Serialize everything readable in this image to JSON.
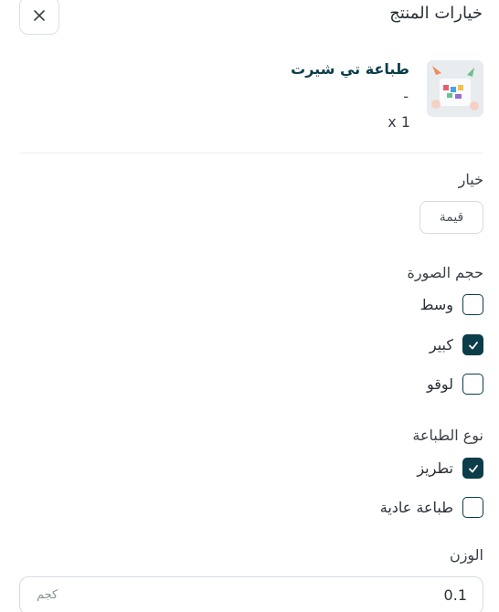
{
  "header": {
    "title": "خيارات المنتج",
    "close_icon": "close-icon"
  },
  "product": {
    "name": "طباعة تي شيرت",
    "variant": "-",
    "quantity": "x 1",
    "image_icon": "product-thumbnail"
  },
  "option_group": {
    "label": "خيار",
    "chip": "قيمة"
  },
  "image_size": {
    "label": "حجم الصورة",
    "options": [
      {
        "label": "وسط",
        "checked": false
      },
      {
        "label": "كبير",
        "checked": true
      },
      {
        "label": "لوقو",
        "checked": false
      }
    ]
  },
  "print_type": {
    "label": "نوع الطباعة",
    "options": [
      {
        "label": "تطريز",
        "checked": true
      },
      {
        "label": "طباعة عادية",
        "checked": false
      }
    ]
  },
  "weight": {
    "label": "الوزن",
    "value": "0.1",
    "unit": "كجم"
  },
  "colors": {
    "accent": "#0b3d4a",
    "border": "#d7dbe0"
  }
}
